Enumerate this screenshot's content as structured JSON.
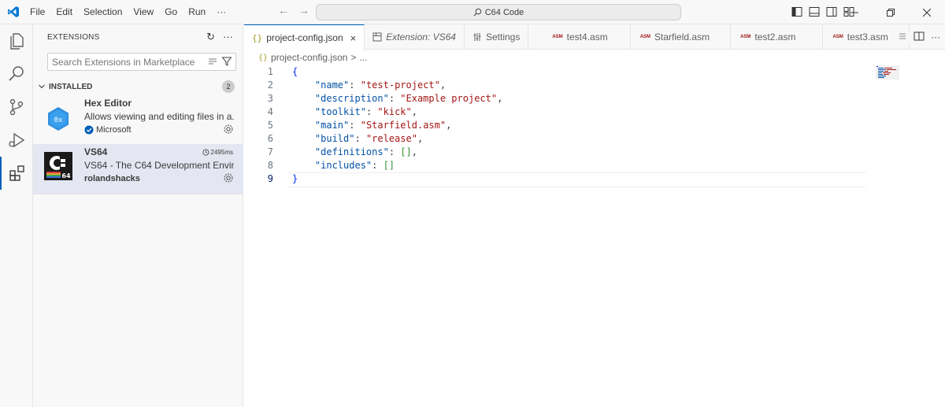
{
  "titlebar": {
    "menu": [
      "File",
      "Edit",
      "Selection",
      "View",
      "Go",
      "Run",
      "···"
    ],
    "command_center": "C64 Code",
    "nav_back": "←",
    "nav_forward": "→"
  },
  "activitybar": {
    "items": [
      "explorer-icon",
      "search-icon",
      "source-control-icon",
      "run-debug-icon",
      "extensions-icon"
    ],
    "active": "extensions-icon"
  },
  "sidebar": {
    "title": "EXTENSIONS",
    "search_placeholder": "Search Extensions in Marketplace",
    "section": {
      "label": "INSTALLED",
      "count": "2"
    },
    "extensions": [
      {
        "name": "Hex Editor",
        "description": "Allows viewing and editing files in a...",
        "publisher": "Microsoft",
        "icon_text": "0x"
      },
      {
        "name": "VS64",
        "description": "VS64 - The C64 Development Envir...",
        "publisher": "rolandshacks",
        "activation_time": "2495ms",
        "icon_text": "64"
      }
    ]
  },
  "editor": {
    "tabs": [
      {
        "label": "project-config.json",
        "icon": "{}",
        "active": true,
        "italic": false
      },
      {
        "label": "Extension: VS64",
        "icon": "extension-preview-icon",
        "active": false,
        "italic": true
      },
      {
        "label": "Settings",
        "icon": "settings-icon",
        "active": false,
        "italic": false
      },
      {
        "label": "test4.asm",
        "icon": "ASM",
        "active": false,
        "italic": false
      },
      {
        "label": "Starfield.asm",
        "icon": "ASM",
        "active": false,
        "italic": false
      },
      {
        "label": "test2.asm",
        "icon": "ASM",
        "active": false,
        "italic": false
      },
      {
        "label": "test3.asm",
        "icon": "ASM",
        "active": false,
        "italic": false
      }
    ],
    "breadcrumb": {
      "file": "project-config.json",
      "sep": ">",
      "rest": "..."
    },
    "current_line": 9,
    "lines": [
      {
        "n": "1",
        "text": "{"
      },
      {
        "n": "2",
        "key": "\"name\"",
        "value": "\"test-project\""
      },
      {
        "n": "3",
        "key": "\"description\"",
        "value": "\"Example project\""
      },
      {
        "n": "4",
        "key": "\"toolkit\"",
        "value": "\"kick\""
      },
      {
        "n": "5",
        "key": "\"main\"",
        "value": "\"Starfield.asm\""
      },
      {
        "n": "6",
        "key": "\"build\"",
        "value": "\"release\""
      },
      {
        "n": "7",
        "key": "\"definitions\"",
        "value": "[]"
      },
      {
        "n": "8",
        "key": "\"includes\"",
        "value": "[]"
      },
      {
        "n": "9",
        "text": "}"
      }
    ]
  },
  "colors": {
    "accent": "#005fb8",
    "json_key": "#0451a5",
    "json_string": "#a31515",
    "json_brace": "#0431fa",
    "json_bracket": "#319331",
    "selected_item_bg": "#e4e6f1"
  }
}
